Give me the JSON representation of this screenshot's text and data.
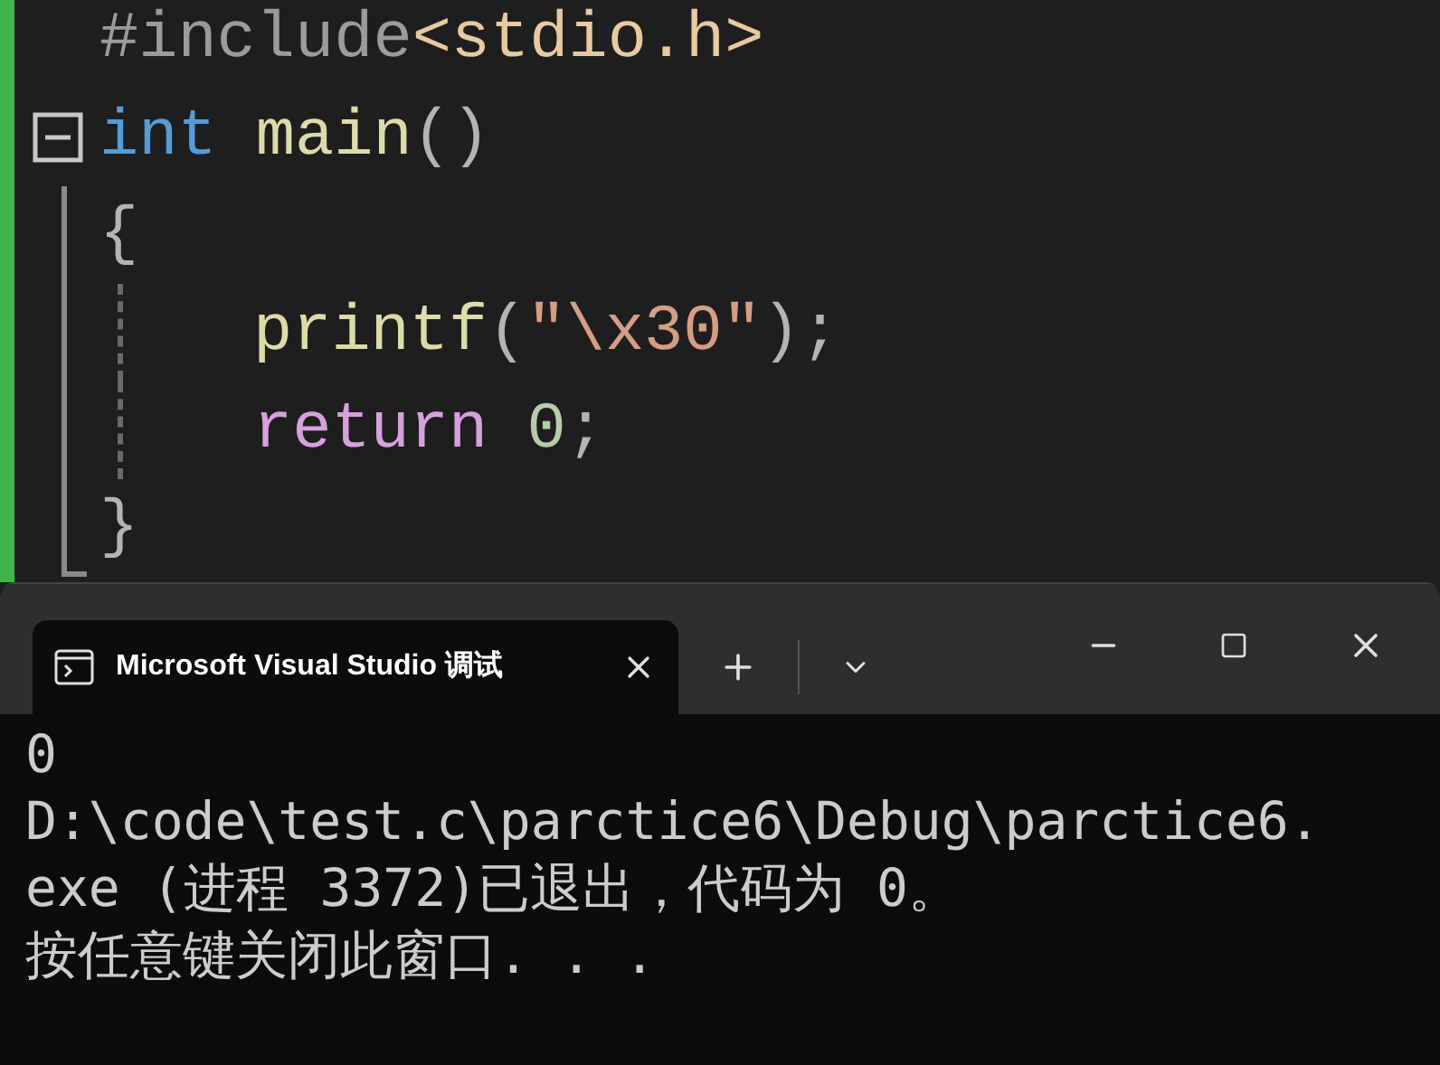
{
  "editor": {
    "lines": [
      {
        "kind": "plain",
        "indented": false,
        "tokens": [
          {
            "kind": "preprocessor",
            "text": "#include"
          },
          {
            "kind": "include_file",
            "text": "<stdio.h>"
          }
        ]
      },
      {
        "kind": "fold_start",
        "indented": false,
        "tokens": [
          {
            "kind": "keyword",
            "text": "int"
          },
          {
            "kind": "function",
            "text": "main",
            "space_before": true
          },
          {
            "kind": "punctuation",
            "text": "()"
          }
        ]
      },
      {
        "kind": "fold_body",
        "indented": false,
        "tokens": [
          {
            "kind": "punctuation",
            "text": "{"
          }
        ]
      },
      {
        "kind": "fold_body",
        "indented": true,
        "tokens": [
          {
            "kind": "function",
            "text": "printf"
          },
          {
            "kind": "punctuation",
            "text": "("
          },
          {
            "kind": "string",
            "text": "\"\\x30\""
          },
          {
            "kind": "punctuation",
            "text": ");"
          }
        ]
      },
      {
        "kind": "fold_body",
        "indented": true,
        "tokens": [
          {
            "kind": "control",
            "text": "return"
          },
          {
            "kind": "number",
            "text": "0",
            "space_before": true
          },
          {
            "kind": "punctuation",
            "text": ";"
          }
        ]
      },
      {
        "kind": "fold_end",
        "indented": false,
        "tokens": [
          {
            "kind": "punctuation",
            "text": "}"
          }
        ]
      }
    ]
  },
  "terminal": {
    "tab": {
      "title": "Microsoft Visual Studio 调试",
      "selected": true
    },
    "output": [
      "0",
      "D:\\code\\test.c\\parctice6\\Debug\\parctice6.",
      "exe (进程 3372)已退出，代码为 0。",
      "按任意键关闭此窗口. . ."
    ]
  }
}
